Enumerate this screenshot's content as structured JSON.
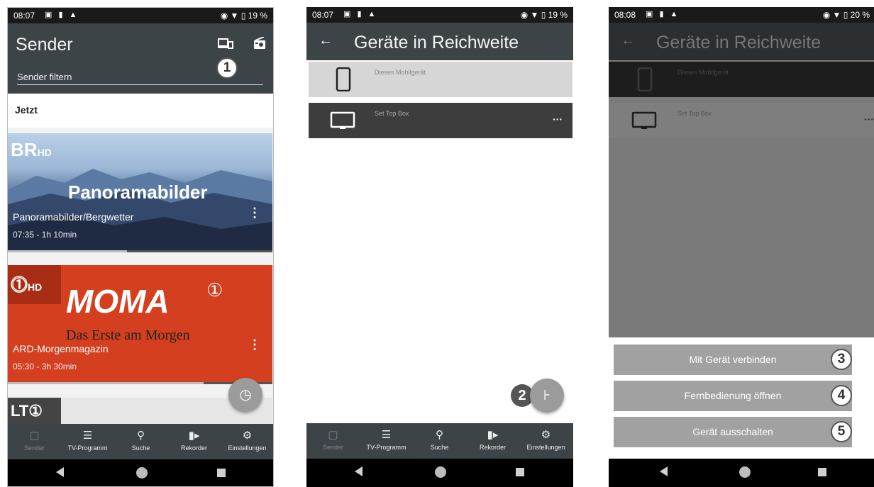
{
  "status1": {
    "time": "08:07",
    "right": "◉ ▼ ▯ 19 %"
  },
  "status2": {
    "time": "08:07",
    "right": "◉ ▼ ▯ 19 %"
  },
  "status3": {
    "time": "08:08",
    "right": "◉ ▼ ▯ 20 %"
  },
  "screen1": {
    "title": "Sender",
    "filter_placeholder": "Sender filtern",
    "badge": "1",
    "section": "Jetzt",
    "cards": [
      {
        "logo": "BR",
        "logo_suffix": "HD",
        "overlay": "Panoramabilder",
        "program": "Panoramabilder/Bergwetter",
        "time": "07:35 - 1h 10min",
        "progress": 0.45
      },
      {
        "logo": "⓵",
        "logo_suffix": "HD",
        "overlay": "MOMA",
        "overlay_mark": "①",
        "overlay_sub": "Das Erste am Morgen",
        "program": "ARD-Morgenmagazin",
        "time": "05:30 - 3h 30min",
        "progress": 0.74
      },
      {
        "logo": "LT①"
      }
    ]
  },
  "screen2": {
    "back": "←",
    "title": "Geräte in Reichweite",
    "devices": [
      {
        "name": "Dieses Mobilgerät"
      },
      {
        "name": "Set Top Box",
        "more": "···"
      }
    ],
    "badge": "2"
  },
  "screen3": {
    "back": "←",
    "title": "Geräte in Reichweite",
    "devices": [
      {
        "name": "Dieses Mobilgerät"
      },
      {
        "name": "Set Top Box",
        "more": "···"
      }
    ],
    "actions": [
      {
        "label": "Mit Gerät verbinden",
        "badge": "3"
      },
      {
        "label": "Fernbedienung öffnen",
        "badge": "4"
      },
      {
        "label": "Gerät ausschalten",
        "badge": "5"
      }
    ]
  },
  "nav": {
    "items": [
      {
        "icon": "tv-icon",
        "label": "Sender",
        "active": true
      },
      {
        "icon": "list-icon",
        "label": "TV-Programm"
      },
      {
        "icon": "search-icon",
        "label": "Suche"
      },
      {
        "icon": "video-camera-icon",
        "label": "Rekorder"
      },
      {
        "icon": "gear-icon",
        "label": "Einstellungen"
      }
    ]
  },
  "colors": {
    "appbar": "#3d4448",
    "overlay": "#7a7a7a",
    "moma": "#d33f1f",
    "sheet_button": "#a1a1a1"
  }
}
